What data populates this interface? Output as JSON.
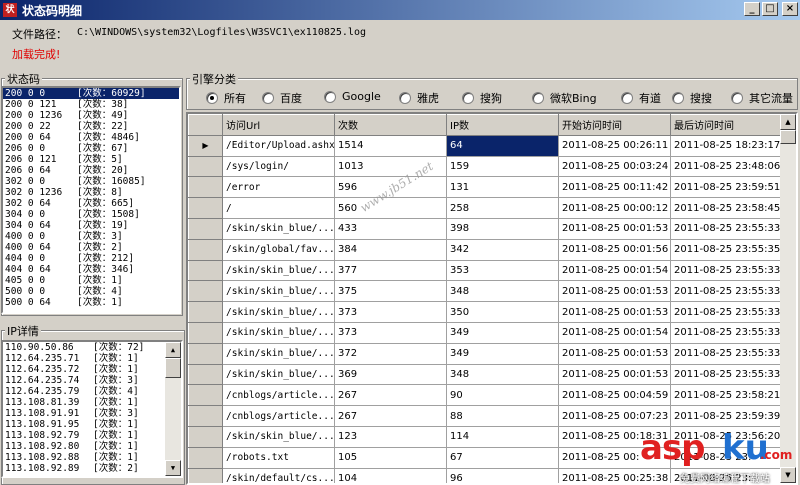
{
  "window": {
    "title": "状态码明细",
    "icon": "app-icon"
  },
  "file_path": {
    "label": "文件路径：",
    "value": "C:\\WINDOWS\\system32\\Logfiles\\W3SVC1\\ex110825.log"
  },
  "status_message": "加载完成!",
  "status_codes": {
    "legend": "状态码",
    "items": [
      {
        "code": "200 0 0",
        "count": "[次数：60929]"
      },
      {
        "code": "200 0 121",
        "count": "[次数：38]"
      },
      {
        "code": "200 0 1236",
        "count": "[次数：49]"
      },
      {
        "code": "200 0 22",
        "count": "[次数：22]"
      },
      {
        "code": "200 0 64",
        "count": "[次数：4846]"
      },
      {
        "code": "206 0 0",
        "count": "[次数：67]"
      },
      {
        "code": "206 0 121",
        "count": "[次数：5]"
      },
      {
        "code": "206 0 64",
        "count": "[次数：20]"
      },
      {
        "code": "302 0 0",
        "count": "[次数：16085]"
      },
      {
        "code": "302 0 1236",
        "count": "[次数：8]"
      },
      {
        "code": "302 0 64",
        "count": "[次数：665]"
      },
      {
        "code": "304 0 0",
        "count": "[次数：1508]"
      },
      {
        "code": "304 0 64",
        "count": "[次数：19]"
      },
      {
        "code": "400 0 0",
        "count": "[次数：3]"
      },
      {
        "code": "400 0 64",
        "count": "[次数：2]"
      },
      {
        "code": "404 0 0",
        "count": "[次数：212]"
      },
      {
        "code": "404 0 64",
        "count": "[次数：346]"
      },
      {
        "code": "405 0 0",
        "count": "[次数：1]"
      },
      {
        "code": "500 0 0",
        "count": "[次数：4]"
      },
      {
        "code": "500 0 64",
        "count": "[次数：1]"
      }
    ]
  },
  "ip_details": {
    "legend": "IP详情",
    "items": [
      {
        "ip": "110.90.50.86",
        "count": "[次数：72]"
      },
      {
        "ip": "112.64.235.71",
        "count": "[次数：1]"
      },
      {
        "ip": "112.64.235.72",
        "count": "[次数：1]"
      },
      {
        "ip": "112.64.235.74",
        "count": "[次数：3]"
      },
      {
        "ip": "112.64.235.79",
        "count": "[次数：4]"
      },
      {
        "ip": "113.108.81.39",
        "count": "[次数：1]"
      },
      {
        "ip": "113.108.91.91",
        "count": "[次数：3]"
      },
      {
        "ip": "113.108.91.95",
        "count": "[次数：1]"
      },
      {
        "ip": "113.108.92.79",
        "count": "[次数：1]"
      },
      {
        "ip": "113.108.92.80",
        "count": "[次数：1]"
      },
      {
        "ip": "113.108.92.88",
        "count": "[次数：1]"
      },
      {
        "ip": "113.108.92.89",
        "count": "[次数：2]"
      }
    ]
  },
  "engine_filter": {
    "legend": "引擎分类",
    "options": [
      "所有",
      "百度",
      "Google",
      "雅虎",
      "搜狗",
      "微软Bing",
      "有道",
      "搜搜",
      "其它流量"
    ],
    "selected": "所有"
  },
  "table": {
    "columns": [
      "访问Url",
      "次数",
      "IP数",
      "开始访问时间",
      "最后访问时间"
    ],
    "rows": [
      [
        "/Editor/Upload.ashx",
        "1514",
        "64",
        "2011-08-25 00:26:11",
        "2011-08-25 18:23:17"
      ],
      [
        "/sys/login/",
        "1013",
        "159",
        "2011-08-25 00:03:24",
        "2011-08-25 23:48:06"
      ],
      [
        "/error",
        "596",
        "131",
        "2011-08-25 00:11:42",
        "2011-08-25 23:59:51"
      ],
      [
        "/",
        "560",
        "258",
        "2011-08-25 00:00:12",
        "2011-08-25 23:58:45"
      ],
      [
        "/skin/skin_blue/...",
        "433",
        "398",
        "2011-08-25 00:01:53",
        "2011-08-25 23:55:33"
      ],
      [
        "/skin/global/fav...",
        "384",
        "342",
        "2011-08-25 00:01:56",
        "2011-08-25 23:55:35"
      ],
      [
        "/skin/skin_blue/...",
        "377",
        "353",
        "2011-08-25 00:01:54",
        "2011-08-25 23:55:33"
      ],
      [
        "/skin/skin_blue/...",
        "375",
        "348",
        "2011-08-25 00:01:53",
        "2011-08-25 23:55:33"
      ],
      [
        "/skin/skin_blue/...",
        "373",
        "350",
        "2011-08-25 00:01:53",
        "2011-08-25 23:55:33"
      ],
      [
        "/skin/skin_blue/...",
        "373",
        "349",
        "2011-08-25 00:01:54",
        "2011-08-25 23:55:33"
      ],
      [
        "/skin/skin_blue/...",
        "372",
        "349",
        "2011-08-25 00:01:53",
        "2011-08-25 23:55:33"
      ],
      [
        "/skin/skin_blue/...",
        "369",
        "348",
        "2011-08-25 00:01:53",
        "2011-08-25 23:55:33"
      ],
      [
        "/cnblogs/article...",
        "267",
        "90",
        "2011-08-25 00:04:59",
        "2011-08-25 23:58:21"
      ],
      [
        "/cnblogs/article...",
        "267",
        "88",
        "2011-08-25 00:07:23",
        "2011-08-25 23:59:39"
      ],
      [
        "/skin/skin_blue/...",
        "123",
        "114",
        "2011-08-25 00:18:31",
        "2011-08-25 23:56:20"
      ],
      [
        "/robots.txt",
        "105",
        "67",
        "2011-08-25 00:",
        "2011-08-25 23:"
      ],
      [
        "/skin/default/cs...",
        "104",
        "96",
        "2011-08-25 00:25:38",
        "2011-08-25 23:"
      ]
    ],
    "selected_row": 0,
    "row_indicator": "▶"
  },
  "watermark": "www.jb51.net",
  "logo": {
    "asp": "asp",
    "ku": "ku",
    "cn": ".com",
    "sub": "免费网络编程下载站"
  }
}
